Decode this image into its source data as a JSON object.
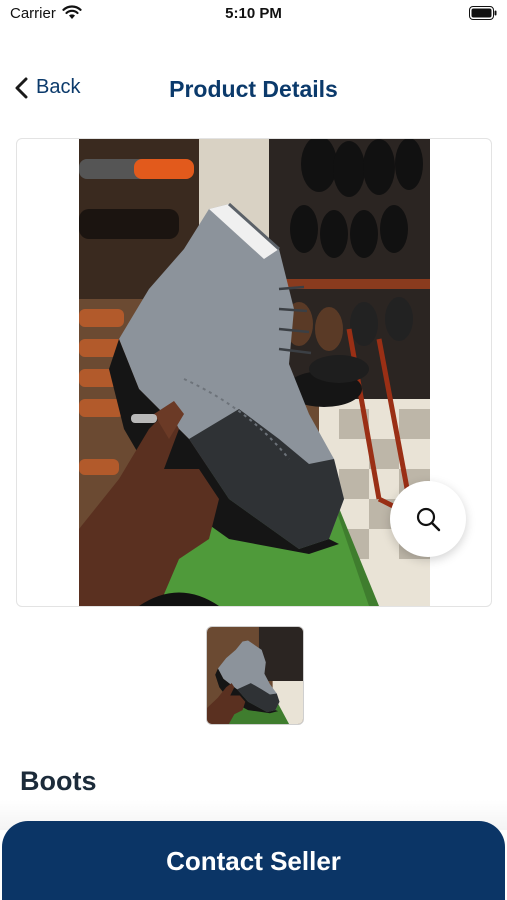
{
  "status_bar": {
    "carrier": "Carrier",
    "time": "5:10 PM",
    "wifi_icon": "wifi-icon",
    "battery_icon": "battery-icon"
  },
  "nav": {
    "back_label": "Back",
    "title": "Product Details",
    "back_icon": "chevron-left-icon"
  },
  "product": {
    "name": "Boots",
    "image_description_icon": "product-photo",
    "zoom_icon": "magnifier-icon"
  },
  "actions": {
    "contact_label": "Contact Seller"
  },
  "colors": {
    "brand": "#0b3566",
    "title": "#0b3a6b",
    "heading": "#1c2b3a"
  }
}
